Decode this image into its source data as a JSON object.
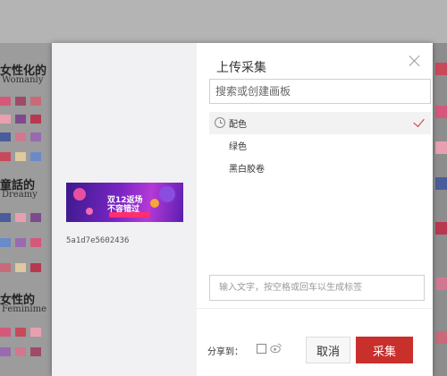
{
  "background": {
    "headings": [
      {
        "title": "女性化的",
        "subtitle": "Womanly"
      },
      {
        "title": "童話的",
        "subtitle": "Dreamy"
      },
      {
        "title": "女性的",
        "subtitle": "Feminime"
      }
    ],
    "palette": [
      "#d4587a",
      "#a04a6a",
      "#7d4b8c",
      "#c86a7a",
      "#e8a0b0",
      "#b83850",
      "#4a5d9a",
      "#6a8ac8",
      "#d07890",
      "#9a6ab0",
      "#c84a5a",
      "#e0c8a0"
    ]
  },
  "dialog": {
    "title": "上传采集",
    "board_search": {
      "placeholder": "搜索或创建画板"
    },
    "boards": [
      {
        "label": "配色",
        "selected": true
      },
      {
        "label": "绿色",
        "selected": false
      },
      {
        "label": "黑白胶卷",
        "selected": false
      }
    ],
    "tag_input": {
      "placeholder": "输入文字，按空格或回车以生成标签"
    },
    "share_label": "分享到：",
    "cancel_label": "取消",
    "collect_label": "采集",
    "preview": {
      "image_id": "5a1d7e5602436",
      "banner_line1": "双12返场",
      "banner_line2": "不容错过"
    },
    "accent_color": "#c9302c"
  }
}
